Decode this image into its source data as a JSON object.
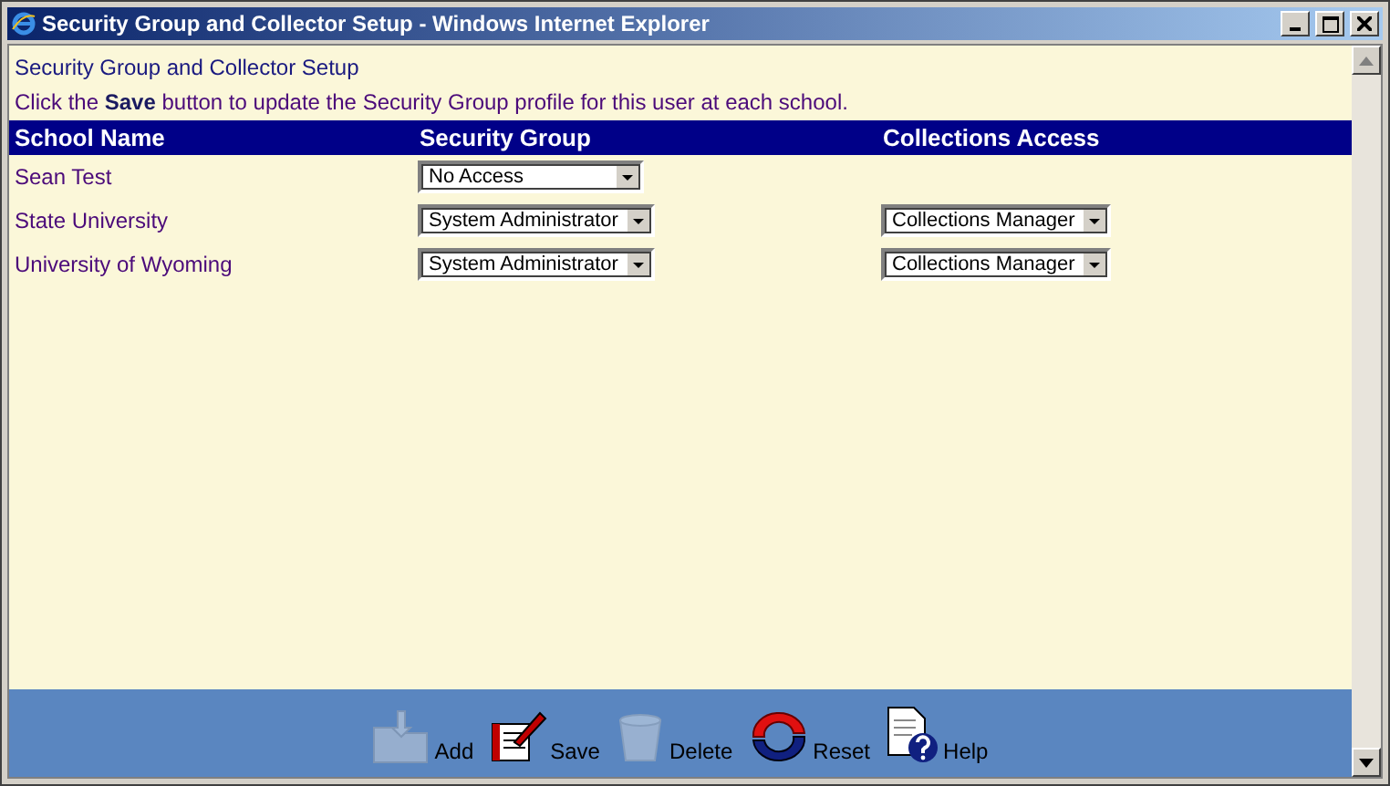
{
  "window": {
    "title": "Security Group and Collector Setup - Windows Internet Explorer"
  },
  "page_title": "Security Group and Collector Setup",
  "instruction": "Click the **Save** button to update the Security Group profile for this user at each school.",
  "table": {
    "columns": [
      "School Name",
      "Security Group",
      "Collections Access"
    ],
    "rows": [
      {
        "school": "Sean Test",
        "security_group": "No Access"
      },
      {
        "school": "State University",
        "security_group": "System Administrator",
        "collections_access": "Collections Manager"
      },
      {
        "school": "University of Wyoming",
        "security_group": "System Administrator",
        "collections_access": "Collections Manager"
      }
    ]
  },
  "toolbar": [
    {
      "kind": "add",
      "label": "Add",
      "disabled": true
    },
    {
      "kind": "save",
      "label": "Save",
      "disabled": false
    },
    {
      "kind": "delete",
      "label": "Delete",
      "disabled": true
    },
    {
      "kind": "reset",
      "label": "Reset",
      "disabled": false
    },
    {
      "kind": "help",
      "label": "Help",
      "disabled": false
    }
  ]
}
